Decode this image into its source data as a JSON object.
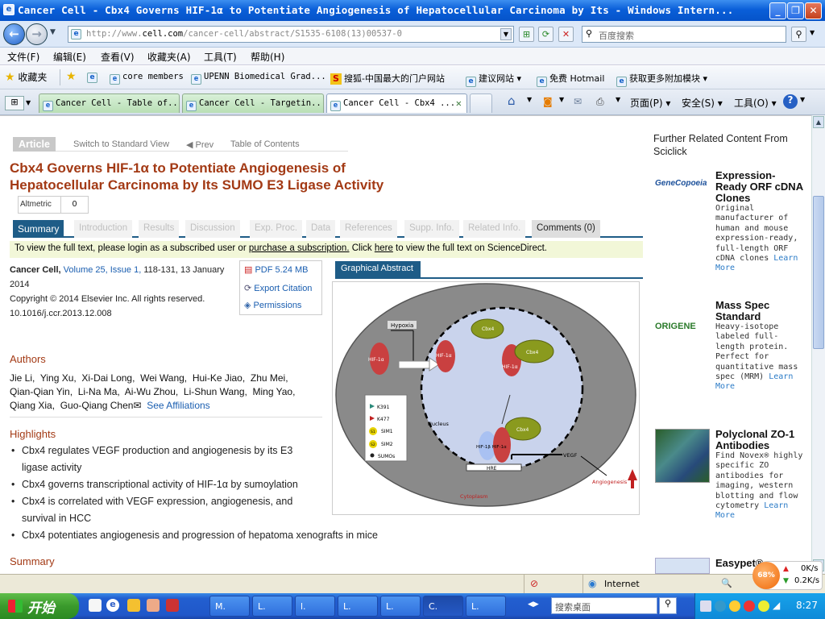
{
  "window": {
    "title": "Cancer Cell - Cbx4 Governs HIF-1α to Potentiate Angiogenesis of Hepatocellular Carcinoma by Its - Windows Intern...",
    "minimize": "_",
    "restore": "❐",
    "close": "✕"
  },
  "address": {
    "url_prefix": "http://www.",
    "url_domain": "cell.com",
    "url_path": "/cancer-cell/abstract/S1535-6108(13)00537-0",
    "search_placeholder": "百度搜索"
  },
  "menu": [
    "文件(F)",
    "编辑(E)",
    "查看(V)",
    "收藏夹(A)",
    "工具(T)",
    "帮助(H)"
  ],
  "favorites": {
    "label": "收藏夹",
    "items": [
      "core members",
      "UPENN Biomedical Grad...",
      "搜狐-中国最大的门户网站",
      "建议网站 ▾",
      "免费 Hotmail",
      "获取更多附加模块 ▾"
    ]
  },
  "tabs": [
    {
      "label": "Cancer Cell - Table of..."
    },
    {
      "label": "Cancer Cell - Targetin..."
    },
    {
      "label": "Cancer Cell - Cbx4 ..."
    }
  ],
  "commands": {
    "page": "页面(P) ▾",
    "safety": "安全(S) ▾",
    "tools": "工具(O) ▾"
  },
  "article": {
    "label": "Article",
    "switch_view": "Switch to Standard View",
    "prev": "◀ Prev",
    "toc": "Table of Contents",
    "title": "Cbx4 Governs HIF-1α to Potentiate Angiogenesis of Hepatocellular Carcinoma by Its SUMO E3 Ligase Activity",
    "altmetric_label": "Altmetric",
    "altmetric_value": "0",
    "tabs": [
      "Summary",
      "Introduction",
      "Results",
      "Discussion",
      "Exp. Proc.",
      "Data",
      "References",
      "Supp. Info.",
      "Related Info.",
      "Comments (0)"
    ],
    "notice": {
      "part1": "To view the full text, please login as a subscribed user or ",
      "link1": "purchase a subscription.",
      "part2": " Click ",
      "link2": "here",
      "part3": " to view the full text on ScienceDirect."
    },
    "journal": "Cancer Cell,",
    "volume": "Volume 25, Issue 1,",
    "pages": " 118-131, 13 January",
    "year": "2014",
    "copyright": "Copyright © 2014 Elsevier Inc. All rights reserved.",
    "doi": "10.1016/j.ccr.2013.12.008",
    "pdf": "PDF 5.24 MB",
    "export": "Export Citation",
    "permissions": "Permissions",
    "authors_head": "Authors",
    "authors": [
      "Jie Li,",
      "Ying Xu,",
      "Xi-Dai Long,",
      "Wei Wang,",
      "Hui-Ke Jiao,",
      "Zhu Mei,",
      "Qian-Qian Yin,",
      "Li-Na Ma,",
      "Ai-Wu Zhou,",
      "Li-Shun Wang,",
      "Ming Yao,",
      "Qiang Xia,",
      "Guo-Qiang Chen"
    ],
    "affiliations": "See Affiliations",
    "highlights_head": "Highlights",
    "highlights": [
      "Cbx4 regulates VEGF production and angiogenesis by its E3 ligase activity",
      "Cbx4 governs transcriptional activity of HIF-1α by sumoylation",
      "Cbx4 is correlated with VEGF expression, angiogenesis, and survival in HCC",
      "Cbx4 potentiates angiogenesis and progression of hepatoma xenografts in mice"
    ],
    "summary_head": "Summary",
    "ga_tab": "Graphical Abstract",
    "ga": {
      "hypoxia": "Hypoxia",
      "hif": "HIF-1α",
      "cbx4": "Cbx4",
      "nucleus": "Nucleus",
      "cytoplasm": "Cytoplasm",
      "vegf": "VEGF",
      "angio": "Angiogenesis",
      "hre": "HRE",
      "hif_pair": "HIF-1β HIF-1α",
      "s1": "S1",
      "s2": "S2",
      "legend": [
        "K391",
        "K477",
        "SIM1",
        "SIM2",
        "SUMOs"
      ]
    }
  },
  "sidebar": {
    "title": "Further Related Content From Sciclick",
    "ads": [
      {
        "brand": "GeneCopoeia",
        "title": "Expression-Ready ORF cDNA Clones",
        "desc": "Original manufacturer of human and mouse expression-ready, full-length ORF cDNA clones",
        "more": "Learn More"
      },
      {
        "brand": "ORIGENE",
        "title": "Mass Spec Standard",
        "desc": "Heavy-isotope labeled full-length protein. Perfect for quantitative mass spec (MRM)",
        "more": "Learn More"
      },
      {
        "brand": "",
        "title": "Polyclonal ZO-1 Antibodies",
        "desc": "Find Novex® highly specific ZO antibodies for imaging, western blotting and flow cytometry",
        "more": "Learn More"
      },
      {
        "brand": "",
        "title": "Easypet®",
        "desc": "",
        "more": ""
      }
    ]
  },
  "status": {
    "zone": "Internet",
    "zoom_icon": "🔍"
  },
  "speed": {
    "percent": "68%",
    "up": "0K/s",
    "down": "0.2K/s"
  },
  "taskbar": {
    "start": "开始",
    "tasks": [
      "M.",
      "L.",
      "l.",
      "L.",
      "L.",
      "C.",
      "L."
    ],
    "search_placeholder": "搜索桌面",
    "time": "8:27"
  },
  "colors": {
    "accent": "#1e5c87",
    "title": "#a33a15",
    "link": "#1a5eb0"
  }
}
